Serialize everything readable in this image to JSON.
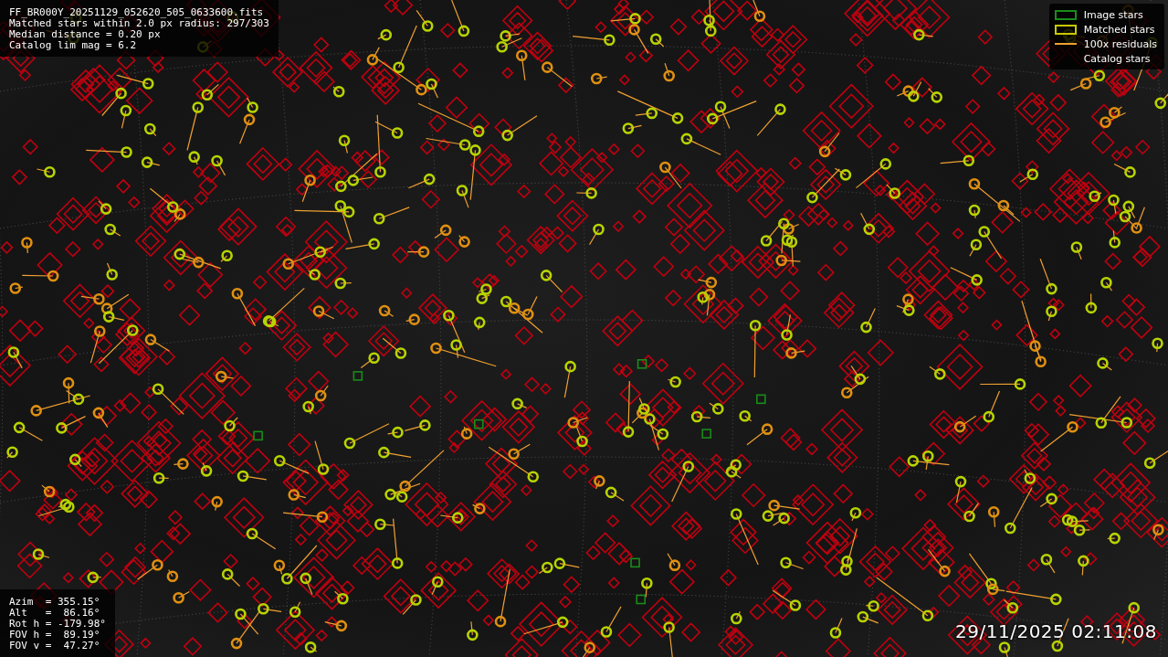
{
  "info": [
    "FF_BR000Y_20251129_052620_505_0633600.fits",
    "Matched stars within 2.0 px radius: 297/303",
    "Median distance = 0.20 px",
    "Catalog lim mag = 6.2"
  ],
  "legend": [
    {
      "kind": "image",
      "label": "Image stars",
      "color": "#1a8c1a"
    },
    {
      "kind": "matched",
      "label": "Matched stars",
      "color": "#c8c800"
    },
    {
      "kind": "residual",
      "label": "100x residuals",
      "color": "#f0a030"
    },
    {
      "kind": "catalog",
      "label": "Catalog stars"
    }
  ],
  "pointing": [
    "Azim  = 355.15°",
    "Alt   =  86.16°",
    "Rot h = -179.98°",
    "FOV h =  89.19°",
    "FOV v =  47.27°"
  ],
  "timestamp": "29/11/2025 02:11:08"
}
